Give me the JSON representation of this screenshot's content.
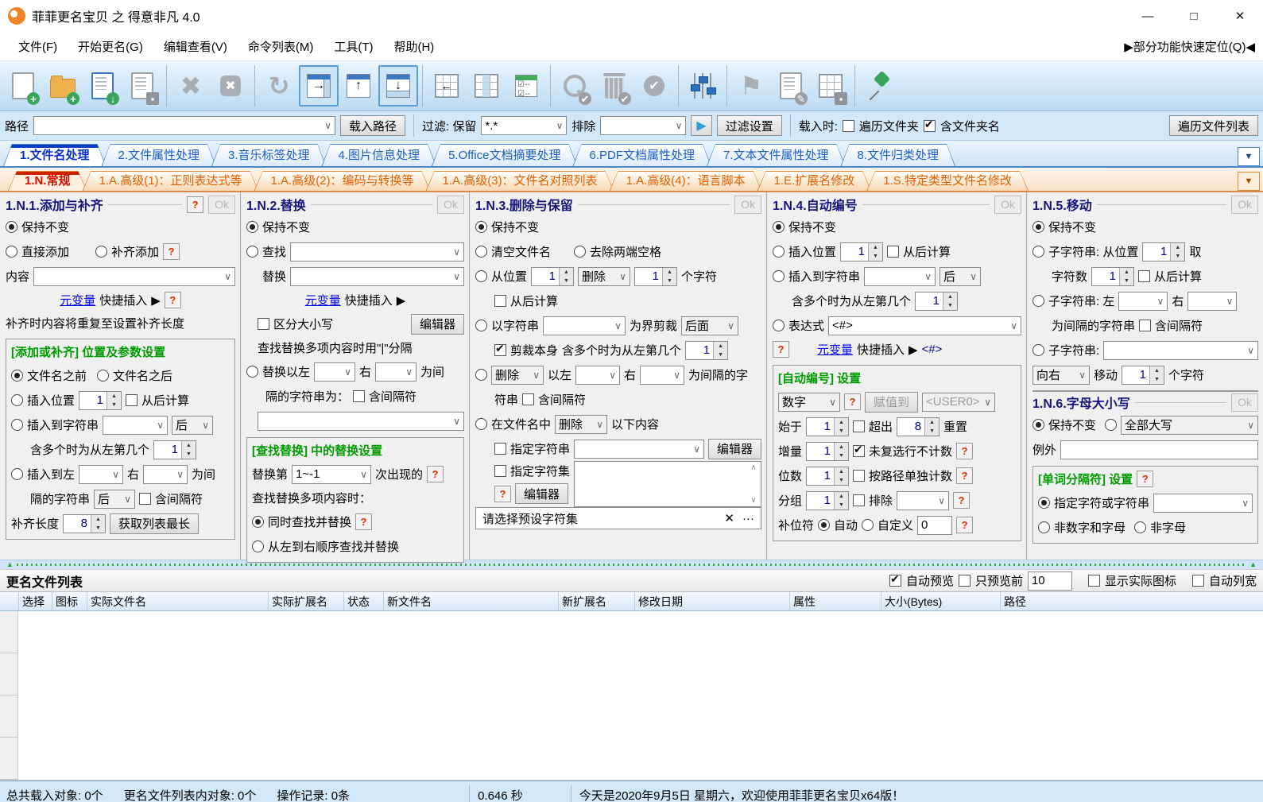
{
  "window": {
    "title": "菲菲更名宝贝 之 得意非凡 4.0",
    "minimize": "—",
    "maximize": "□",
    "close": "✕"
  },
  "menu": {
    "items": [
      "文件(F)",
      "开始更名(G)",
      "编辑查看(V)",
      "命令列表(M)",
      "工具(T)",
      "帮助(H)"
    ],
    "quick_locate": "▶部分功能快速定位(Q)◀"
  },
  "toolbar": {
    "buttons": [
      "new-file",
      "add-folder",
      "import-list",
      "save-list",
      "delete-x",
      "remove-box",
      "refresh",
      "panel-right",
      "panel-top",
      "panel-bottom",
      "grid-insert-left",
      "grid-columns",
      "checklist",
      "search-check",
      "delete-check",
      "apply-check",
      "tune-sliders",
      "flag",
      "edit-list",
      "export-table",
      "pin"
    ],
    "glyphs": {
      "plus": "+",
      "down": "↓",
      "up": "↑",
      "right": "→",
      "left": "←",
      "x": "✖",
      "refresh": "↻",
      "check": "✔",
      "flag": "⚑",
      "pencil": "✎"
    }
  },
  "pathbar": {
    "path_label": "路径",
    "path_value": "",
    "load_path_button": "载入路径",
    "filter_label": "过滤: 保留",
    "filter_value": "*.*",
    "exclude_label": "排除",
    "exclude_value": "",
    "play": "▶",
    "filter_settings_button": "过滤设置",
    "load_when_label": "载入时:",
    "traverse_folders": "遍历文件夹",
    "include_folder_names": "含文件夹名",
    "traverse_list_button": "遍历文件列表"
  },
  "tabs_main": {
    "items": [
      "1.文件名处理",
      "2.文件属性处理",
      "3.音乐标签处理",
      "4.图片信息处理",
      "5.Office文档摘要处理",
      "6.PDF文档属性处理",
      "7.文本文件属性处理",
      "8.文件归类处理"
    ],
    "dropdown": "▼"
  },
  "tabs_sub": {
    "items": [
      "1.N.常规",
      "1.A.高级(1)：正则表达式等",
      "1.A.高级(2)：编码与转换等",
      "1.A.高级(3)：文件名对照列表",
      "1.A.高级(4)：语言脚本",
      "1.E.扩展名修改",
      "1.S.特定类型文件名修改"
    ],
    "dropdown": "▼"
  },
  "p1": {
    "title": "1.N.1.添加与补齐",
    "help": "?",
    "ok": "Ok",
    "keep": "保持不变",
    "direct_add": "直接添加",
    "pad_add": "补齐添加",
    "content_label": "内容",
    "var_link": "元变量",
    "var_insert": "快捷插入",
    "var_arrow": "▶",
    "note": "补齐时内容将重复至设置补齐长度",
    "group_title": "[添加或补齐] 位置及参数设置",
    "before_name": "文件名之前",
    "after_name": "文件名之后",
    "insert_pos": "插入位置",
    "pos_value": "1",
    "from_end": "从后计算",
    "insert_to_str": "插入到字符串",
    "after_opt": "后",
    "multi_hint": "含多个时为从左第几个",
    "multi_value": "1",
    "between_head": "插入到左",
    "right_label": "右",
    "between_tail": "为间",
    "between_wrap": "隔的字符串",
    "after_opt2": "后",
    "include_sep": "含间隔符",
    "pad_len_label": "补齐长度",
    "pad_len": "8",
    "get_longest_button": "获取列表最长"
  },
  "p2": {
    "title": "1.N.2.替换",
    "ok": "Ok",
    "keep": "保持不变",
    "find": "查找",
    "replace": "替换",
    "var_link": "元变量",
    "var_insert": "快捷插入",
    "var_arrow": "▶",
    "case_sensitive": "区分大小写",
    "editor_button": "编辑器",
    "sep_hint": "查找替换多项内容时用\"|\"分隔",
    "between_head": "替换以左",
    "right_label": "右",
    "between_tail": "为间",
    "between_wrap": "隔的字符串为：",
    "include_sep": "含间隔符",
    "group_title": "[查找替换] 中的替换设置",
    "nth_pre": "替换第",
    "nth_value": "1~-1",
    "nth_post": "次出现的",
    "multi_mode": "查找替换多项内容时：",
    "simultaneous": "同时查找并替换",
    "sequential": "从左到右顺序查找并替换"
  },
  "p3": {
    "title": "1.N.3.删除与保留",
    "ok": "Ok",
    "keep": "保持不变",
    "clear_name": "清空文件名",
    "trim_spaces": "去除两端空格",
    "from_pos": "从位置",
    "pos_value": "1",
    "del_opt": "删除",
    "count_value": "1",
    "chars": "个字符",
    "from_end": "从后计算",
    "by_str": "以字符串",
    "cut_label": "为界剪裁",
    "cut_opt": "后面",
    "cut_self": "剪裁本身",
    "multi_hint": "含多个时为从左第几个",
    "multi_value": "1",
    "del2_opt": "删除",
    "between_head": "以左",
    "right_label": "右",
    "between_tail": "为间隔的字",
    "between_wrap": "符串",
    "include_sep": "含间隔符",
    "in_name": "在文件名中",
    "del3_opt": "删除",
    "following": "以下内容",
    "spec_str": "指定字符串",
    "editor_button": "编辑器",
    "spec_set": "指定字符集",
    "editor2_button": "编辑器",
    "help": "?",
    "preset_placeholder": "请选择预设字符集",
    "clear_glyph": "✕",
    "more_glyph": "···"
  },
  "p4": {
    "title": "1.N.4.自动编号",
    "ok": "Ok",
    "keep": "保持不变",
    "insert_pos": "插入位置",
    "pos_value": "1",
    "from_end": "从后计算",
    "insert_to_str": "插入到字符串",
    "after_opt": "后",
    "multi_hint": "含多个时为从左第几个",
    "multi_value": "1",
    "expr_label": "表达式",
    "expr_value": "<#>",
    "help": "?",
    "var_link": "元变量",
    "var_insert": "快捷插入",
    "var_arrow": "▶",
    "expr_tag": "<#>",
    "group_title": "[自动编号] 设置",
    "type_value": "数字",
    "assign_button": "赋值到",
    "assign_target": "<USER0>",
    "start_label": "始于",
    "start_value": "1",
    "over_label": "超出",
    "over_value": "8",
    "reset_label": "重置",
    "inc_label": "增量",
    "inc_value": "1",
    "uncheck_label": "未复选行不计数",
    "digits_label": "位数",
    "digits_value": "1",
    "by_path_label": "按路径单独计数",
    "grp_label": "分组",
    "grp_value": "1",
    "exclude_label": "排除",
    "pad_label": "补位符",
    "auto_label": "自动",
    "custom_label": "自定义",
    "custom_value": "0"
  },
  "p5": {
    "title": "1.N.5.移动",
    "ok": "Ok",
    "keep": "保持不变",
    "sub1_head": "子字符串: 从位置",
    "pos_value": "1",
    "take": "取",
    "chars_label": "字符数",
    "chars_value": "1",
    "from_end": "从后计算",
    "sub2_head": "子字符串: 左",
    "right_label": "右",
    "sep_line": "为间隔的字符串",
    "include_sep": "含间隔符",
    "sub3_head": "子字符串:",
    "dir_value": "向右",
    "move_label": "移动",
    "move_value": "1",
    "unit": "个字符"
  },
  "p6": {
    "title": "1.N.6.字母大小写",
    "ok": "Ok",
    "keep": "保持不变",
    "case_value": "全部大写",
    "except_label": "例外",
    "group_title": "[单词分隔符] 设置",
    "help": "?",
    "spec_label": "指定字符或字符串",
    "non_alnum": "非数字和字母",
    "non_alpha": "非字母"
  },
  "filelist": {
    "title": "更名文件列表",
    "auto_preview": "自动预览",
    "preview_first": "只预览前",
    "preview_count": "10",
    "show_icons": "显示实际图标",
    "auto_width": "自动列宽",
    "columns": [
      "选择",
      "图标",
      "实际文件名",
      "实际扩展名",
      "状态",
      "新文件名",
      "新扩展名",
      "修改日期",
      "属性",
      "大小(Bytes)",
      "路径"
    ]
  },
  "statusbar": {
    "loaded": "总共载入对象: 0个",
    "in_list": "更名文件列表内对象: 0个",
    "ops": "操作记录: 0条",
    "time": "0.646 秒",
    "welcome": "今天是2020年9月5日 星期六，欢迎使用菲菲更名宝贝x64版！"
  }
}
